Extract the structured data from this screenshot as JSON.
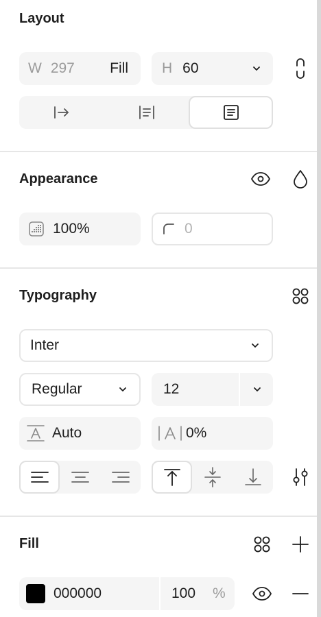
{
  "layout": {
    "title": "Layout",
    "width_label": "W",
    "width_value": "297",
    "width_mode": "Fill",
    "height_label": "H",
    "height_value": "60"
  },
  "appearance": {
    "title": "Appearance",
    "opacity": "100%",
    "radius": "0"
  },
  "typography": {
    "title": "Typography",
    "font_family": "Inter",
    "font_weight": "Regular",
    "font_size": "12",
    "line_height": "Auto",
    "letter_spacing": "0%"
  },
  "fill": {
    "title": "Fill",
    "color_hex": "000000",
    "swatch_color": "#000000",
    "opacity_value": "100",
    "opacity_unit": "%"
  }
}
